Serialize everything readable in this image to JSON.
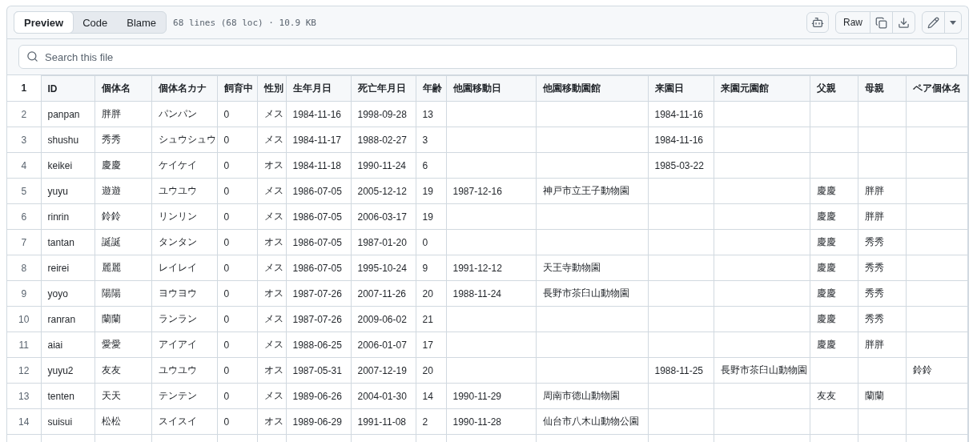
{
  "toolbar": {
    "tabs": [
      {
        "label": "Preview",
        "selected": true
      },
      {
        "label": "Code",
        "selected": false
      },
      {
        "label": "Blame",
        "selected": false
      }
    ],
    "file_info": "68 lines (68 loc) · 10.9 KB",
    "raw_button": "Raw"
  },
  "search": {
    "placeholder": "Search this file"
  },
  "table": {
    "header": {
      "line": "1",
      "cells": [
        "ID",
        "個体名",
        "個体名カナ",
        "飼育中",
        "性別",
        "生年月日",
        "死亡年月日",
        "年齢",
        "他園移動日",
        "他園移動園館",
        "来園日",
        "来園元園館",
        "父親",
        "母親",
        "ペア個体名"
      ]
    },
    "rows": [
      {
        "line": "2",
        "cells": [
          "panpan",
          "胖胖",
          "パンパン",
          "0",
          "メス",
          "1984-11-16",
          "1998-09-28",
          "13",
          null,
          null,
          "1984-11-16",
          null,
          null,
          null,
          null
        ]
      },
      {
        "line": "3",
        "cells": [
          "shushu",
          "秀秀",
          "シュウシュウ",
          "0",
          "メス",
          "1984-11-17",
          "1988-02-27",
          "3",
          null,
          null,
          "1984-11-16",
          null,
          null,
          null,
          null
        ]
      },
      {
        "line": "4",
        "cells": [
          "keikei",
          "慶慶",
          "ケイケイ",
          "0",
          "オス",
          "1984-11-18",
          "1990-11-24",
          "6",
          null,
          null,
          "1985-03-22",
          null,
          null,
          null,
          null
        ]
      },
      {
        "line": "5",
        "cells": [
          "yuyu",
          "遊遊",
          "ユウユウ",
          "0",
          "メス",
          "1986-07-05",
          "2005-12-12",
          "19",
          "1987-12-16",
          "神戸市立王子動物園",
          null,
          null,
          "慶慶",
          "胖胖",
          null
        ]
      },
      {
        "line": "6",
        "cells": [
          "rinrin",
          "鈴鈴",
          "リンリン",
          "0",
          "メス",
          "1986-07-05",
          "2006-03-17",
          "19",
          null,
          null,
          null,
          null,
          "慶慶",
          "胖胖",
          null
        ]
      },
      {
        "line": "7",
        "cells": [
          "tantan",
          "誕誕",
          "タンタン",
          "0",
          "オス",
          "1986-07-05",
          "1987-01-20",
          "0",
          null,
          null,
          null,
          null,
          "慶慶",
          "秀秀",
          null
        ]
      },
      {
        "line": "8",
        "cells": [
          "reirei",
          "麗麗",
          "レイレイ",
          "0",
          "メス",
          "1986-07-05",
          "1995-10-24",
          "9",
          "1991-12-12",
          "天王寺動物園",
          null,
          null,
          "慶慶",
          "秀秀",
          null
        ]
      },
      {
        "line": "9",
        "cells": [
          "yoyo",
          "陽陽",
          "ヨウヨウ",
          "0",
          "オス",
          "1987-07-26",
          "2007-11-26",
          "20",
          "1988-11-24",
          "長野市茶臼山動物園",
          null,
          null,
          "慶慶",
          "秀秀",
          null
        ]
      },
      {
        "line": "10",
        "cells": [
          "ranran",
          "蘭蘭",
          "ランラン",
          "0",
          "メス",
          "1987-07-26",
          "2009-06-02",
          "21",
          null,
          null,
          null,
          null,
          "慶慶",
          "秀秀",
          null
        ]
      },
      {
        "line": "11",
        "cells": [
          "aiai",
          "愛愛",
          "アイアイ",
          "0",
          "メス",
          "1988-06-25",
          "2006-01-07",
          "17",
          null,
          null,
          null,
          null,
          "慶慶",
          "胖胖",
          null
        ]
      },
      {
        "line": "12",
        "cells": [
          "yuyu2",
          "友友",
          "ユウユウ",
          "0",
          "オス",
          "1987-05-31",
          "2007-12-19",
          "20",
          null,
          null,
          "1988-11-25",
          "長野市茶臼山動物園",
          null,
          null,
          "鈴鈴"
        ]
      },
      {
        "line": "13",
        "cells": [
          "tenten",
          "天天",
          "テンテン",
          "0",
          "メス",
          "1989-06-26",
          "2004-01-30",
          "14",
          "1990-11-29",
          "周南市徳山動物園",
          null,
          null,
          "友友",
          "蘭蘭",
          null
        ]
      },
      {
        "line": "14",
        "cells": [
          "suisui",
          "松松",
          "スイスイ",
          "0",
          "オス",
          "1989-06-29",
          "1991-11-08",
          "2",
          "1990-11-28",
          "仙台市八木山動物公園",
          null,
          null,
          null,
          null,
          null
        ]
      }
    ]
  }
}
